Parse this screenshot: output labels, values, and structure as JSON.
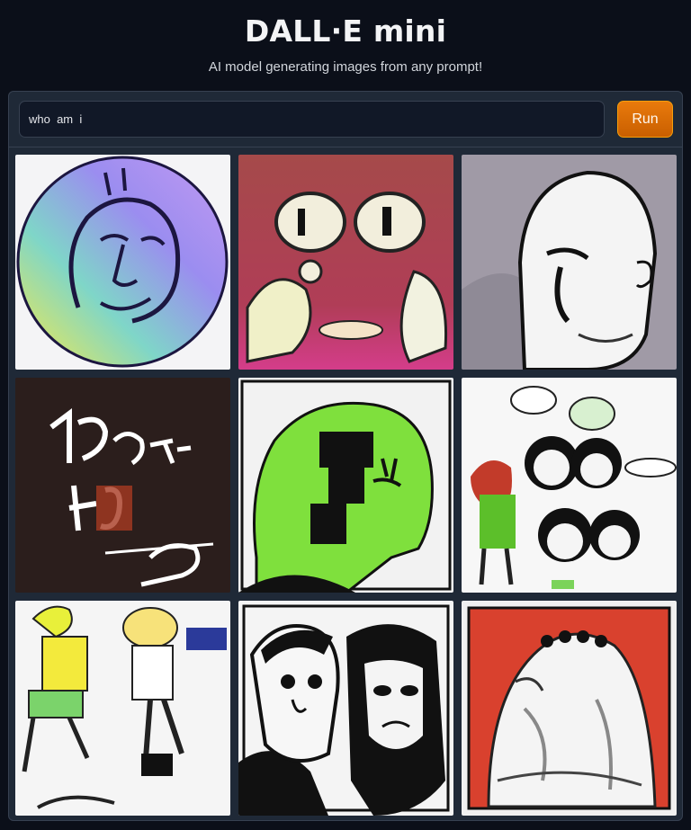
{
  "app": {
    "title": "DALL·E mini",
    "subtitle": "AI model generating images from any prompt!"
  },
  "prompt": {
    "value": "who  am  i",
    "placeholder": ""
  },
  "run_button": {
    "label": "Run",
    "color": "#e2710a"
  },
  "gallery": {
    "images": [
      {
        "name": "generated-image-1",
        "content": "rainbow circle with abstract face"
      },
      {
        "name": "generated-image-2",
        "content": "cartoon eyes and hands on red background"
      },
      {
        "name": "generated-image-3",
        "content": "white bald cartoon figure"
      },
      {
        "name": "generated-image-4",
        "content": "white scribbled lettering on dark brown"
      },
      {
        "name": "generated-image-5",
        "content": "green blob with black shapes"
      },
      {
        "name": "generated-image-6",
        "content": "group of cartoon characters with speech bubbles"
      },
      {
        "name": "generated-image-7",
        "content": "two cartoon figures in yellow and blue"
      },
      {
        "name": "generated-image-8",
        "content": "black and white portrait of two faces"
      },
      {
        "name": "generated-image-9",
        "content": "white ghost-like figure on red"
      }
    ]
  },
  "colors": {
    "background": "#0b0f19",
    "panel": "#1f2937",
    "accent": "#e2710a"
  }
}
